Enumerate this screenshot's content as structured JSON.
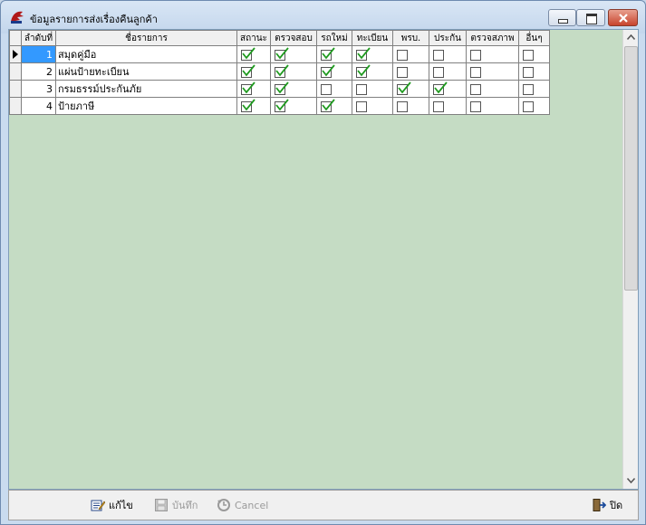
{
  "window": {
    "title": "ข้อมูลรายการส่งเรื่องคืนลูกค้า"
  },
  "grid": {
    "columns": [
      "ลำดับที่",
      "ชื่อรายการ",
      "สถานะ",
      "ตรวจสอบ",
      "รถใหม่",
      "ทะเบียน",
      "พรบ.",
      "ประกัน",
      "ตรวจสภาพ",
      "อื่นๆ"
    ],
    "rows": [
      {
        "no": "1",
        "name": "สมุดคู่มือ",
        "checks": [
          true,
          true,
          true,
          true,
          false,
          false,
          false,
          false
        ]
      },
      {
        "no": "2",
        "name": "แผ่นป้ายทะเบียน",
        "checks": [
          true,
          true,
          true,
          true,
          false,
          false,
          false,
          false
        ]
      },
      {
        "no": "3",
        "name": "กรมธรรม์ประกันภัย",
        "checks": [
          true,
          true,
          false,
          false,
          true,
          true,
          false,
          false
        ]
      },
      {
        "no": "4",
        "name": "ป้ายภาษี",
        "checks": [
          true,
          true,
          true,
          false,
          false,
          false,
          false,
          false
        ]
      }
    ],
    "selected_row": 0
  },
  "toolbar": {
    "edit_label": "แก้ไข",
    "save_label": "บันทึก",
    "cancel_label": "Cancel",
    "close_label": "ปิด"
  },
  "colors": {
    "client_background": "#c5dcc4",
    "selected_cell": "#3399ff",
    "check_mark": "#1f9a1f"
  }
}
